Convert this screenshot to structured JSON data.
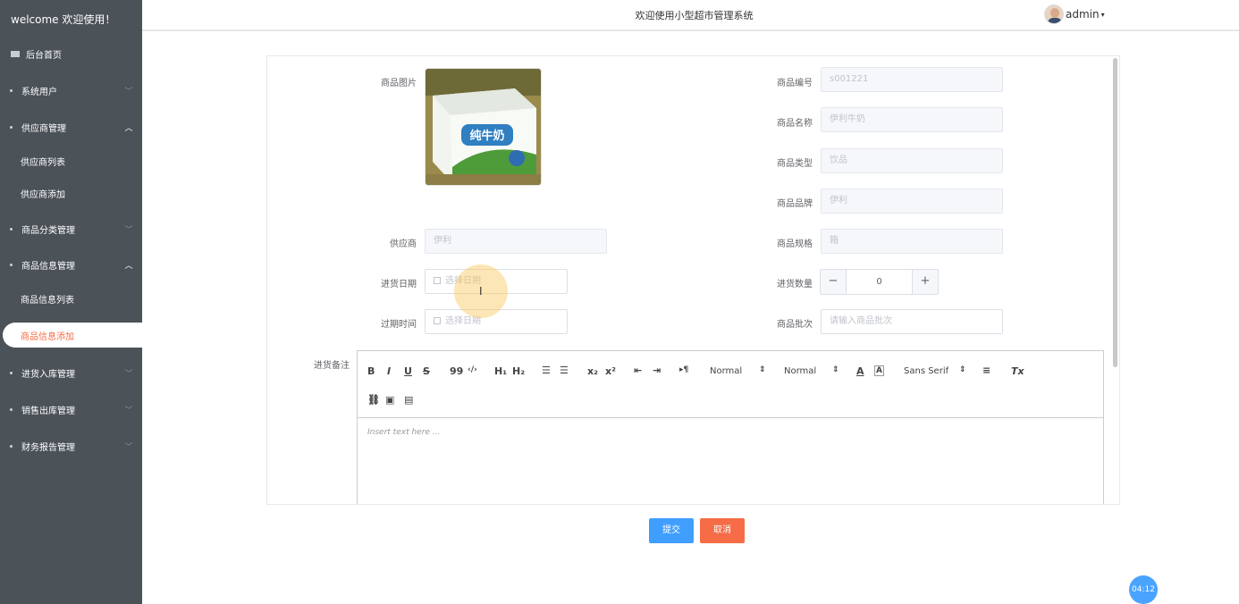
{
  "sidebar": {
    "brand": "welcome 欢迎使用！",
    "home": "后台首页",
    "items": [
      {
        "label": "系统用户"
      },
      {
        "label": "供应商管理"
      },
      {
        "label": "商品分类管理"
      },
      {
        "label": "商品信息管理"
      },
      {
        "label": "进货入库管理"
      },
      {
        "label": "销售出库管理"
      },
      {
        "label": "财务报告管理"
      }
    ],
    "subs": [
      {
        "label": "供应商列表"
      },
      {
        "label": "供应商添加"
      },
      {
        "label": "商品信息列表"
      },
      {
        "label": "商品信息添加"
      }
    ]
  },
  "header": {
    "title": "欢迎使用小型超市管理系统",
    "user": "admin"
  },
  "form": {
    "photo_label": "商品图片",
    "code_label": "商品编号",
    "code_value": "s001221",
    "name_label": "商品名称",
    "name_value": "伊利牛奶",
    "type_label": "商品类型",
    "type_value": "饮品",
    "brand_label": "商品品牌",
    "brand_value": "伊利",
    "supplier_label": "供应商",
    "supplier_value": "伊利",
    "spec_label": "商品规格",
    "spec_value": "箱",
    "date_label": "进货日期",
    "date_placeholder": "选择日期",
    "qty_label": "进货数量",
    "qty_value": "0",
    "expire_label": "过期时间",
    "expire_placeholder": "选择日期",
    "batch_label": "商品批次",
    "batch_placeholder": "请输入商品批次",
    "note_label": "进货备注",
    "product_box_text": "纯牛奶"
  },
  "editor": {
    "bold": "B",
    "italic": "I",
    "underline": "U",
    "strike": "S",
    "quote": "99",
    "code": "‹/›",
    "h1": "H₁",
    "h2": "H₂",
    "sub": "x₂",
    "sup": "x²",
    "rtl": "▸¶",
    "size_select": "Normal",
    "header_select": "Normal",
    "font_select": "Sans Serif",
    "clean": "Tx",
    "placeholder": "Insert text here ..."
  },
  "buttons": {
    "submit": "提交",
    "cancel": "取消"
  },
  "timer": "04:12",
  "colors": {
    "sidebar": "#4b5258",
    "primary": "#409eff",
    "danger": "#f56c47"
  }
}
